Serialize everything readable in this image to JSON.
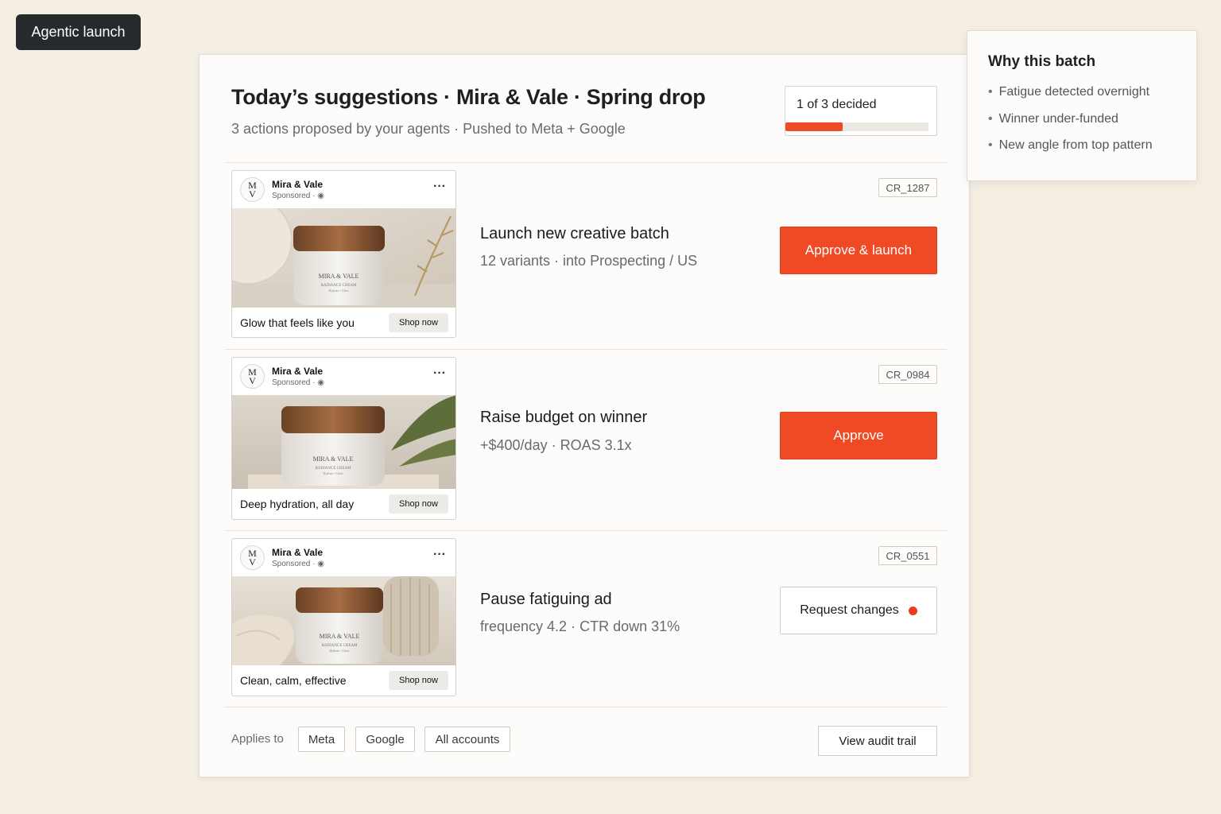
{
  "brand": {
    "label": "Agentic launch"
  },
  "header": {
    "title": "Today’s suggestions · Mira & Vale · Spring drop",
    "subtitle": "3 actions proposed by your agents · Pushed to Meta + Google",
    "progress": {
      "label": "1 of 3 decided",
      "fraction": 0.4
    }
  },
  "suggestions": [
    {
      "ad": {
        "brand": "Mira & Vale",
        "sponsored": "Sponsored ·",
        "logo_top": "M",
        "logo_bottom": "V",
        "caption": "Glow that feels like you",
        "cta": "Shop now",
        "jar_label": "MIRA & VALE",
        "jar_sub": "RADIANCE CREAM",
        "jar_sub2": "Hydrate • Glow"
      },
      "id": "CR_1287",
      "title": "Launch new creative batch",
      "detail": "12 variants · into Prospecting / US",
      "action": "Approve & launch"
    },
    {
      "ad": {
        "brand": "Mira & Vale",
        "sponsored": "Sponsored ·",
        "logo_top": "M",
        "logo_bottom": "V",
        "caption": "Deep hydration, all day",
        "cta": "Shop now",
        "jar_label": "MIRA & VALE",
        "jar_sub": "RADIANCE CREAM",
        "jar_sub2": "Hydrate • Glow"
      },
      "id": "CR_0984",
      "title": "Raise budget on winner",
      "detail": "+$400/day · ROAS 3.1x",
      "action": "Approve"
    },
    {
      "ad": {
        "brand": "Mira & Vale",
        "sponsored": "Sponsored ·",
        "logo_top": "M",
        "logo_bottom": "V",
        "caption": "Clean, calm, effective",
        "cta": "Shop now",
        "jar_label": "MIRA & VALE",
        "jar_sub": "RADIANCE CREAM",
        "jar_sub2": "Hydrate • Glow"
      },
      "id": "CR_0551",
      "title": "Pause fatiguing ad",
      "detail": "frequency 4.2 · CTR down 31%",
      "action": "Request changes"
    }
  ],
  "footer": {
    "applies_label": "Applies to",
    "chips": [
      "Meta",
      "Google",
      "All accounts"
    ],
    "audit": "View audit trail"
  },
  "why": {
    "title": "Why this batch",
    "items": [
      "Fatigue detected overnight",
      "Winner under-funded",
      "New angle from top pattern"
    ]
  },
  "colors": {
    "accent": "#ef4a24",
    "background": "#f5efe3",
    "dark": "#272a2c"
  },
  "icons": {
    "globe": "globe-icon",
    "more": "more-icon",
    "status": "status-dot-icon"
  }
}
